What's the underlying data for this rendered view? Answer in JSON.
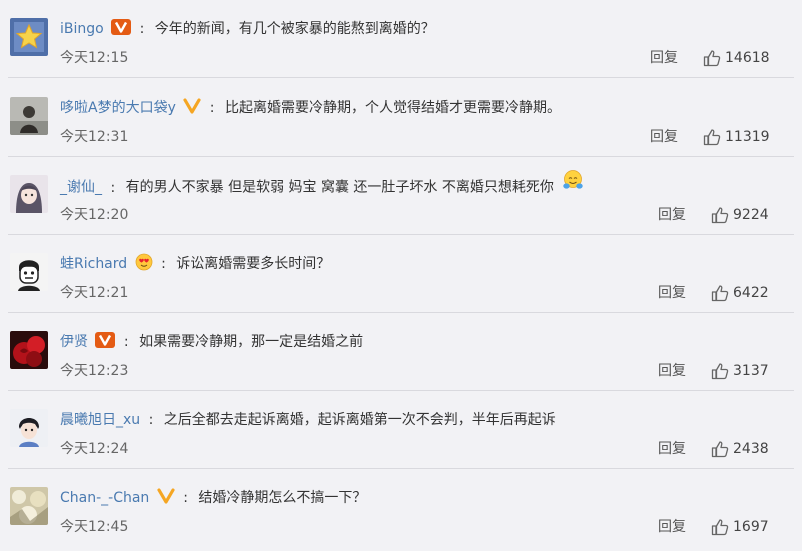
{
  "colors": {
    "background": "#f2f2f5",
    "username": "#4a7ab0",
    "divider": "#d9d9de",
    "verified_badge": "#e45b14",
    "vip_badge": "#f5a623"
  },
  "reply_label": "回复",
  "comments": [
    {
      "username": "iBingo",
      "badge": "verified-orange-v-icon",
      "text": "今年的新闻，有几个被家暴的能熬到离婚的？",
      "time": "今天12:15",
      "likes": "14618",
      "avatar": "star-avatar"
    },
    {
      "username": "哆啦A梦的大口袋y",
      "badge": "vip-yellow-v-icon",
      "text": "比起离婚需要冷静期，个人觉得结婚才更需要冷静期。",
      "time": "今天12:31",
      "likes": "11319",
      "avatar": "person-avatar"
    },
    {
      "username": "_谢仙_",
      "badge": "",
      "text": "有的男人不家暴 但是软弱 妈宝 窝囊 还一肚子坏水 不离婚只想耗死你",
      "time": "今天12:20",
      "likes": "9224",
      "avatar": "anime-avatar",
      "emoji": "hug-emoji-icon"
    },
    {
      "username": "蛙Richard",
      "badge": "heart-eyes-badge-icon",
      "text": "诉讼离婚需要多长时间？",
      "time": "今天12:21",
      "likes": "6422",
      "avatar": "cartoon-face-avatar"
    },
    {
      "username": "伊贤",
      "badge": "verified-orange-v-icon",
      "text": "如果需要冷静期，那一定是结婚之前",
      "time": "今天12:23",
      "likes": "3137",
      "avatar": "red-rose-avatar"
    },
    {
      "username": "晨曦旭日_xu",
      "badge": "",
      "text": "之后全都去走起诉离婚，起诉离婚第一次不会判，半年后再起诉",
      "time": "今天12:24",
      "likes": "2438",
      "avatar": "boy-avatar"
    },
    {
      "username": "Chan-_-Chan",
      "badge": "vip-yellow-v-icon",
      "text": "结婚冷静期怎么不搞一下？",
      "time": "今天12:45",
      "likes": "1697",
      "avatar": "flower-avatar"
    }
  ]
}
